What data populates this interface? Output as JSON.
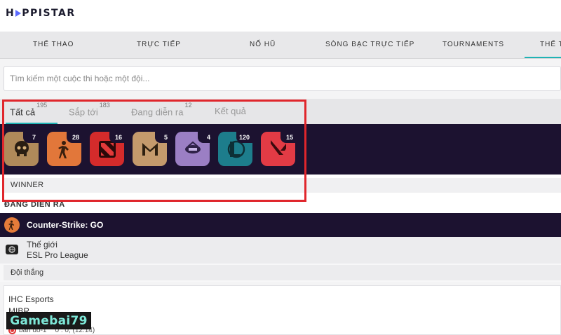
{
  "brand": {
    "logo_text_left": "H",
    "logo_text_right": "PPISTAR"
  },
  "nav": {
    "items": [
      {
        "label": "THỂ THAO"
      },
      {
        "label": "TRỰC TIẾP"
      },
      {
        "label": "NỔ HŨ"
      },
      {
        "label": "SÒNG BẠC TRỰC TIẾP"
      },
      {
        "label": "TOURNAMENTS"
      },
      {
        "label": "THỂ T"
      }
    ]
  },
  "search": {
    "placeholder": "Tìm kiếm một cuộc thi hoặc một đội..."
  },
  "tabs": [
    {
      "label": "Tất cả",
      "count": "195",
      "active": true
    },
    {
      "label": "Sắp tới",
      "count": "183",
      "active": false
    },
    {
      "label": "Đang diễn ra",
      "count": "12",
      "active": false
    },
    {
      "label": "Kết quả",
      "count": "",
      "active": false
    }
  ],
  "sports": [
    {
      "icon": "dota-skull-icon",
      "count": "7",
      "color": "#b08a5a"
    },
    {
      "icon": "counter-strike-icon",
      "count": "28",
      "color": "#e2773a"
    },
    {
      "icon": "dota2-icon",
      "count": "16",
      "color": "#d42b2b"
    },
    {
      "icon": "mobile-legends-icon",
      "count": "5",
      "color": "#c49a6c"
    },
    {
      "icon": "king-of-glory-icon",
      "count": "4",
      "color": "#9b7fc4"
    },
    {
      "icon": "league-of-legends-icon",
      "count": "120",
      "color": "#1d7d8c"
    },
    {
      "icon": "valorant-icon",
      "count": "15",
      "color": "#e23b45"
    }
  ],
  "winner_label": "WINNER",
  "live_heading": "ĐANG DIỄN RA",
  "game": {
    "name": "Counter-Strike: GO"
  },
  "region": {
    "line1": "Thế giới",
    "line2": "ESL Pro League"
  },
  "market": {
    "label": "Đội thắng"
  },
  "match": {
    "team1": "IHC Esports",
    "team2": "MIBR",
    "map": "bản đồ-1",
    "score": "0 : 0, (12:14)"
  },
  "watermark": {
    "text": "Gamebai79"
  },
  "colors": {
    "accent": "#1fb3b5",
    "dark_bar": "#1c1230",
    "highlight": "#e0262c"
  }
}
